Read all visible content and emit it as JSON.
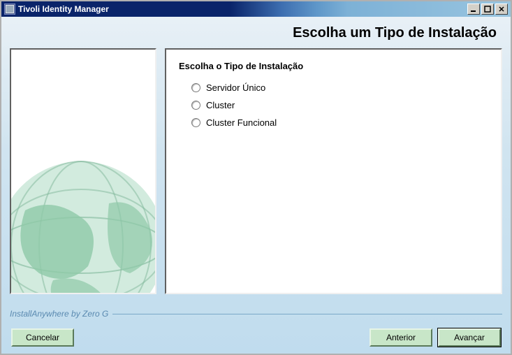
{
  "window": {
    "title": "Tivoli Identity Manager"
  },
  "page": {
    "title": "Escolha um Tipo de Instalação"
  },
  "panel": {
    "heading": "Escolha o Tipo de Instalação",
    "options": [
      {
        "label": "Servidor Único"
      },
      {
        "label": "Cluster"
      },
      {
        "label": "Cluster Funcional"
      }
    ]
  },
  "footer": {
    "branding": "InstallAnywhere by Zero G"
  },
  "buttons": {
    "cancel": "Cancelar",
    "back": "Anterior",
    "next": "Avançar"
  }
}
